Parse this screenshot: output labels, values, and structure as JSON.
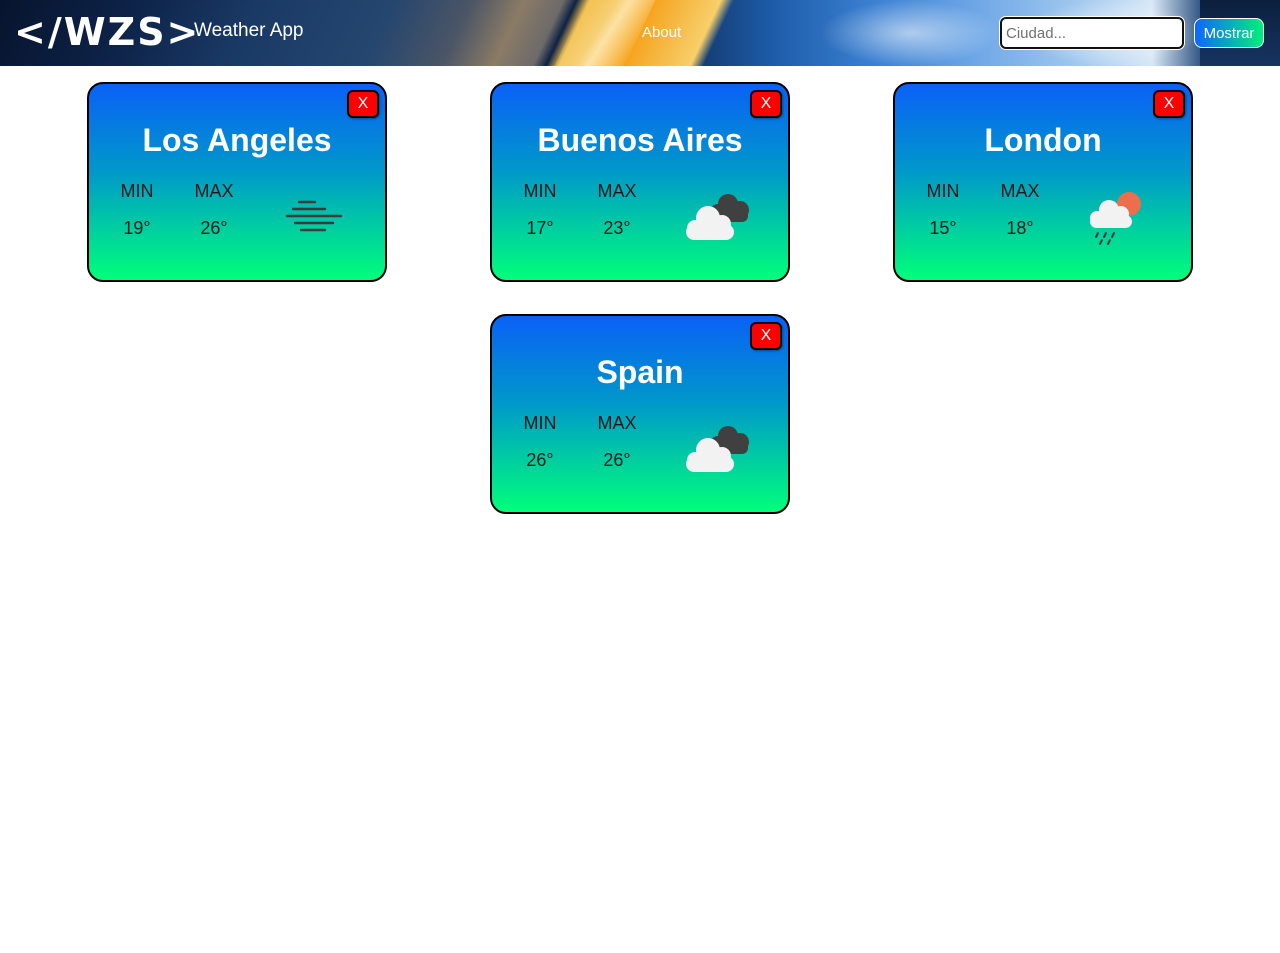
{
  "header": {
    "logo": "</WZS>",
    "app_name": "Weather App",
    "about_label": "About",
    "search": {
      "placeholder": "Ciudad...",
      "value": ""
    },
    "submit_label": "Mostrar"
  },
  "cards": [
    {
      "city": "Los Angeles",
      "min_label": "MIN",
      "max_label": "MAX",
      "min": "19°",
      "max": "26°",
      "close_label": "X",
      "icon": "mist-icon"
    },
    {
      "city": "Buenos Aires",
      "min_label": "MIN",
      "max_label": "MAX",
      "min": "17°",
      "max": "23°",
      "close_label": "X",
      "icon": "broken-clouds-icon"
    },
    {
      "city": "London",
      "min_label": "MIN",
      "max_label": "MAX",
      "min": "15°",
      "max": "18°",
      "close_label": "X",
      "icon": "rain-sun-cloud-icon"
    },
    {
      "city": "Spain",
      "min_label": "MIN",
      "max_label": "MAX",
      "min": "26°",
      "max": "26°",
      "close_label": "X",
      "icon": "broken-clouds-icon"
    }
  ],
  "colors": {
    "card_gradient_top": "#0a61f6",
    "card_gradient_bottom": "#00ff7a",
    "close_button": "#ff0000",
    "button_gradient_start": "#0d66ff",
    "button_gradient_end": "#00f07a"
  }
}
